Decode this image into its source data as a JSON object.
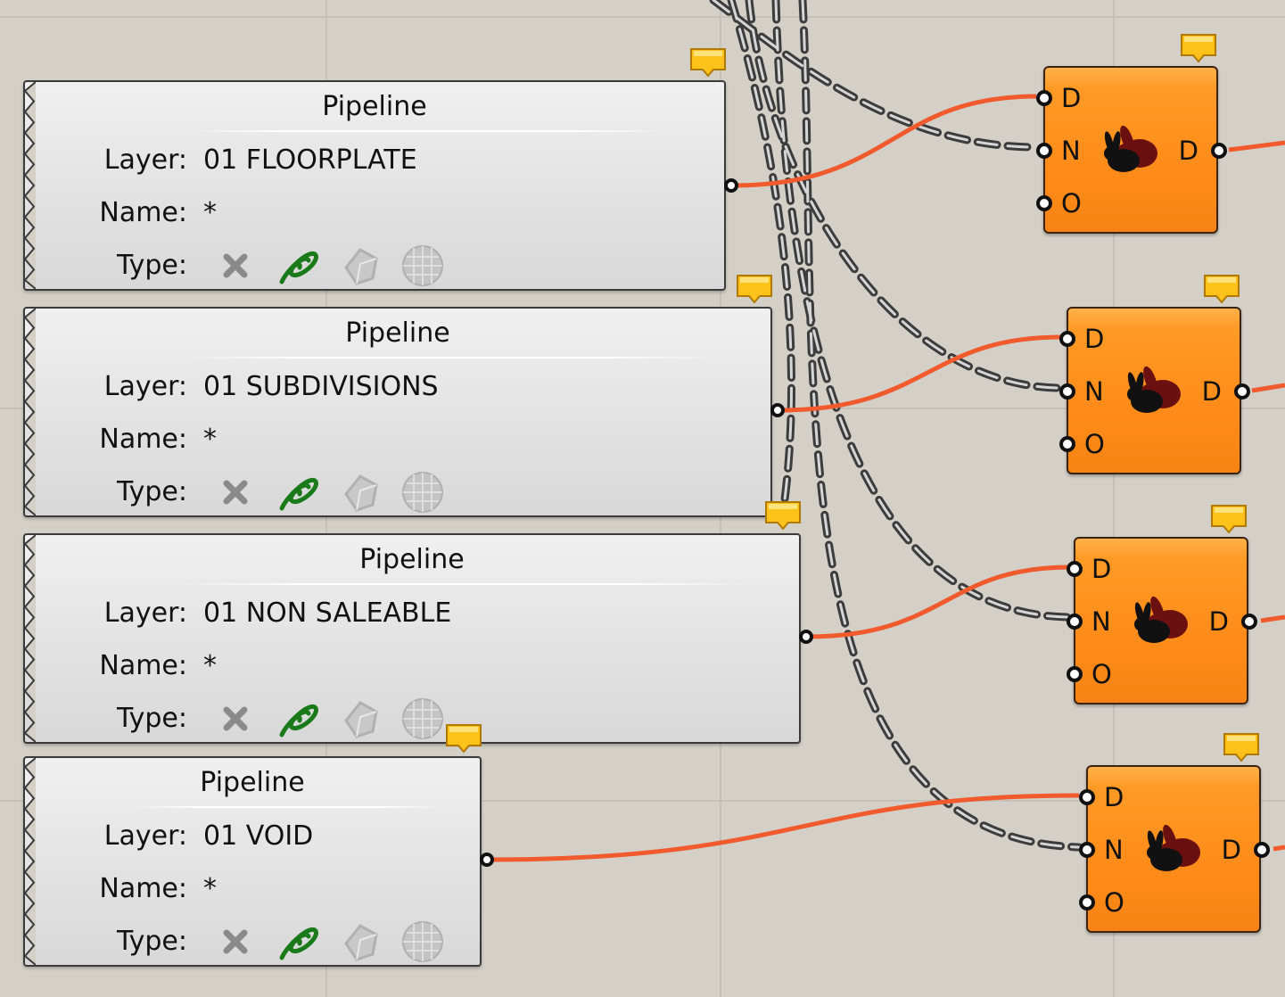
{
  "canvas": {
    "background": "#d4d0c8"
  },
  "colors": {
    "wire_data": "#f05a2c",
    "wire_dashed": "#4a4a4a",
    "component_orange": "#ff8c1a",
    "pipeline_grey": "#e6e6e6",
    "bubble_yellow": "#ffc21a"
  },
  "pipelines": [
    {
      "title": "Pipeline",
      "layer_label": "Layer:",
      "layer_value": "01 FLOORPLATE",
      "name_label": "Name:",
      "name_value": "*",
      "type_label": "Type:",
      "type_icons": [
        "cross-icon",
        "curve-icon",
        "surface-icon",
        "mesh-icon"
      ]
    },
    {
      "title": "Pipeline",
      "layer_label": "Layer:",
      "layer_value": "01 SUBDIVISIONS",
      "name_label": "Name:",
      "name_value": "*",
      "type_label": "Type:",
      "type_icons": [
        "cross-icon",
        "curve-icon",
        "surface-icon",
        "mesh-icon"
      ]
    },
    {
      "title": "Pipeline",
      "layer_label": "Layer:",
      "layer_value": "01 NON SALEABLE",
      "name_label": "Name:",
      "name_value": "*",
      "type_label": "Type:",
      "type_icons": [
        "cross-icon",
        "curve-icon",
        "surface-icon",
        "mesh-icon"
      ]
    },
    {
      "title": "Pipeline",
      "layer_label": "Layer:",
      "layer_value": "01 VOID",
      "name_label": "Name:",
      "name_value": "*",
      "type_label": "Type:",
      "type_icons": [
        "cross-icon",
        "curve-icon",
        "surface-icon",
        "mesh-icon"
      ]
    }
  ],
  "data_nodes": [
    {
      "inputs": [
        "D",
        "N",
        "O"
      ],
      "output": "D",
      "icon": "rabbit-icon"
    },
    {
      "inputs": [
        "D",
        "N",
        "O"
      ],
      "output": "D",
      "icon": "rabbit-icon"
    },
    {
      "inputs": [
        "D",
        "N",
        "O"
      ],
      "output": "D",
      "icon": "rabbit-icon"
    },
    {
      "inputs": [
        "D",
        "N",
        "O"
      ],
      "output": "D",
      "icon": "rabbit-icon"
    }
  ]
}
